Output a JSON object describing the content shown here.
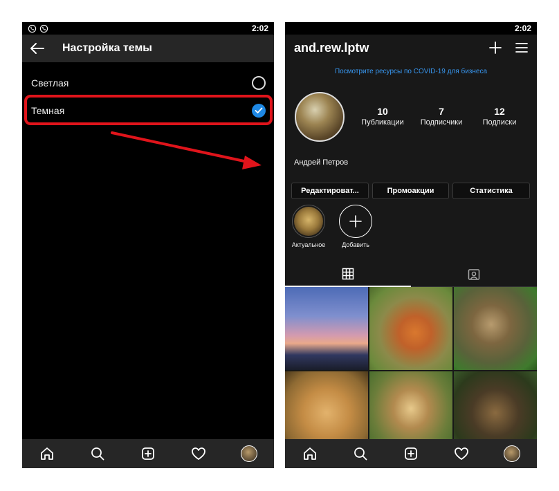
{
  "left_screen": {
    "status": {
      "time": "2:02",
      "icons": [
        "viber-icon",
        "viber-icon"
      ]
    },
    "header": {
      "back_icon": "arrow-left-icon",
      "title": "Настройка темы"
    },
    "options": [
      {
        "label": "Светлая",
        "selected": false
      },
      {
        "label": "Темная",
        "selected": true
      }
    ],
    "annotation": {
      "color": "#e0141b"
    },
    "nav": [
      "home-icon",
      "search-icon",
      "new-post-icon",
      "heart-icon",
      "profile-avatar"
    ]
  },
  "right_screen": {
    "status": {
      "time": "2:02"
    },
    "header": {
      "username": "and.rew.lptw",
      "icons": [
        "plus-icon",
        "menu-icon"
      ]
    },
    "covid_link": "Посмотрите ресурсы по COVID-19 для бизнеса",
    "stats": [
      {
        "value": "10",
        "label": "Публикации"
      },
      {
        "value": "7",
        "label": "Подписчики"
      },
      {
        "value": "12",
        "label": "Подписки"
      }
    ],
    "display_name": "Андрей Петров",
    "buttons": [
      "Редактироват...",
      "Промоакции",
      "Статистика"
    ],
    "highlights": [
      {
        "label": "Актуальное"
      },
      {
        "label": "Добавить"
      }
    ],
    "tabs": [
      "grid-icon",
      "tagged-icon"
    ],
    "grid": [
      "sunset-mountains",
      "fox",
      "owl",
      "rabbits",
      "monkeys",
      "wild-dog"
    ],
    "nav": [
      "home-icon",
      "search-icon",
      "new-post-icon",
      "heart-icon",
      "profile-avatar"
    ]
  },
  "colors": {
    "accent": "#3897f0",
    "check": "#1e88e5",
    "highlight": "#e0141b",
    "header_bg": "#262626"
  }
}
